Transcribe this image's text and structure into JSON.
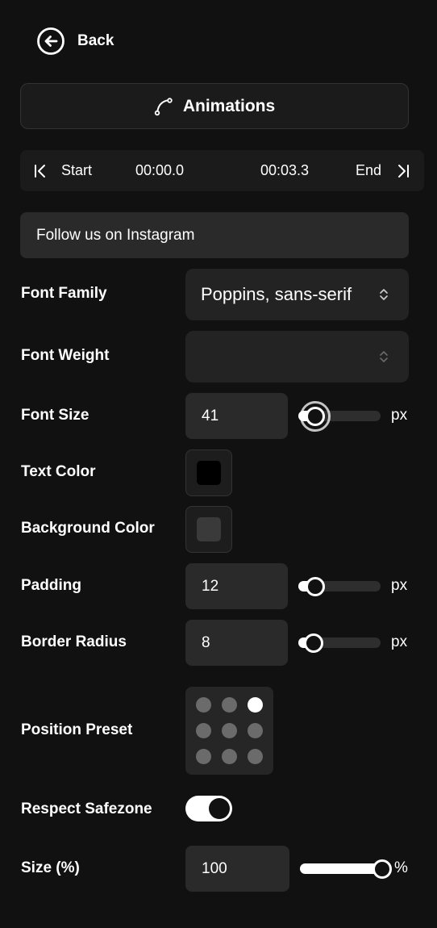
{
  "header": {
    "back_label": "Back",
    "animations_label": "Animations"
  },
  "timeline": {
    "start_label": "Start",
    "start_time": "00:00.0",
    "end_time": "00:03.3",
    "end_label": "End"
  },
  "text_field": {
    "value": "Follow us on Instagram"
  },
  "font_family": {
    "label": "Font Family",
    "value": "Poppins, sans-serif"
  },
  "font_weight": {
    "label": "Font Weight",
    "value": ""
  },
  "font_size": {
    "label": "Font Size",
    "value": "41",
    "unit": "px",
    "slider_fraction": 0.12
  },
  "text_color": {
    "label": "Text Color",
    "color": "#000000"
  },
  "background_color": {
    "label": "Background Color",
    "color": "#3a3a3a"
  },
  "padding": {
    "label": "Padding",
    "value": "12",
    "unit": "px",
    "slider_fraction": 0.12
  },
  "border_radius": {
    "label": "Border Radius",
    "value": "8",
    "unit": "px",
    "slider_fraction": 0.1
  },
  "position_preset": {
    "label": "Position Preset",
    "selected": "top-right"
  },
  "respect_safezone": {
    "label": "Respect Safezone",
    "enabled": true
  },
  "size": {
    "label": "Size (%)",
    "value": "100",
    "unit": "%",
    "slider_fraction": 1.0
  },
  "colors": {
    "background": "#111111",
    "panel": "#1b1b1b",
    "input": "#2a2a2a",
    "accent": "#ffffff"
  }
}
